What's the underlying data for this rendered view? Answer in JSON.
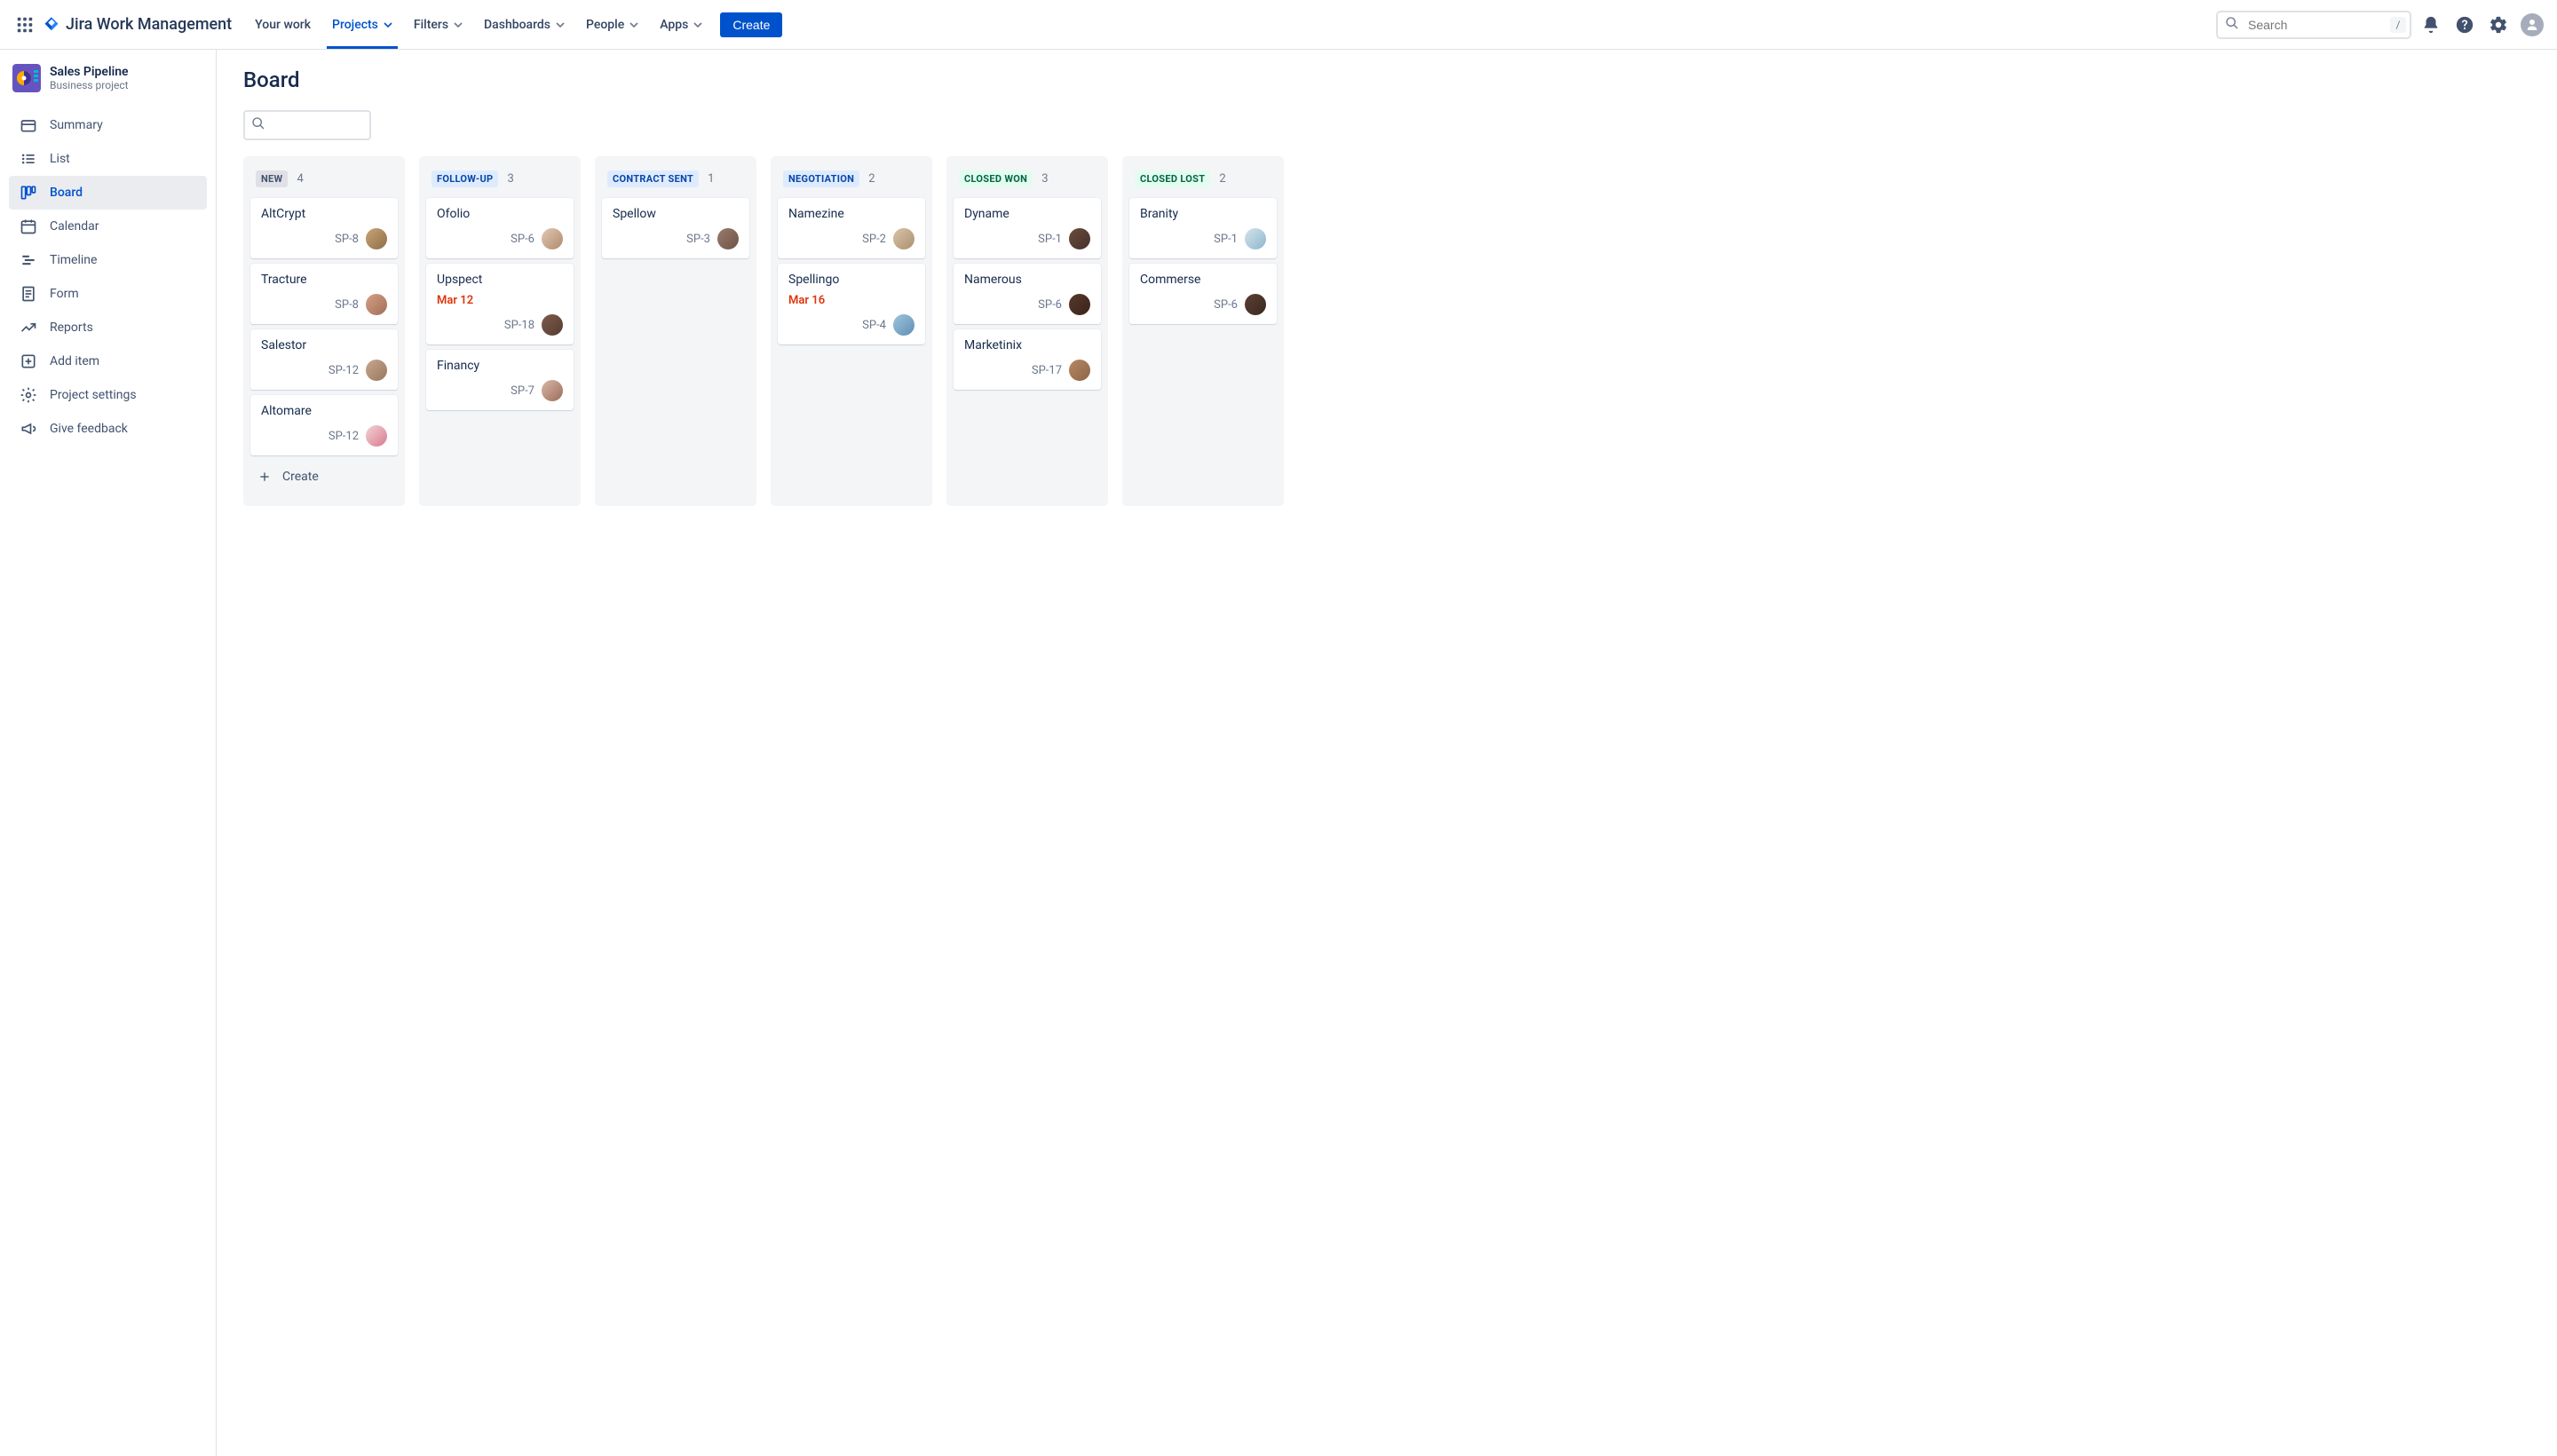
{
  "app_name": "Jira Work Management",
  "nav": {
    "your_work": "Your work",
    "projects": "Projects",
    "filters": "Filters",
    "dashboards": "Dashboards",
    "people": "People",
    "apps": "Apps",
    "create": "Create"
  },
  "search": {
    "placeholder": "Search",
    "shortcut": "/"
  },
  "project": {
    "name": "Sales Pipeline",
    "subtitle": "Business project"
  },
  "sidebar": {
    "summary": "Summary",
    "list": "List",
    "board": "Board",
    "calendar": "Calendar",
    "timeline": "Timeline",
    "form": "Form",
    "reports": "Reports",
    "add_item": "Add item",
    "project_settings": "Project settings",
    "give_feedback": "Give feedback"
  },
  "page_title": "Board",
  "columns": [
    {
      "title": "NEW",
      "count": "4",
      "status": "grey",
      "cards": [
        {
          "title": "AltCrypt",
          "key": "SP-8",
          "avatar": "linear-gradient(135deg,#c9a574,#8f6d49)"
        },
        {
          "title": "Tracture",
          "key": "SP-8",
          "avatar": "linear-gradient(135deg,#d4a088,#a06f55)"
        },
        {
          "title": "Salestor",
          "key": "SP-12",
          "avatar": "linear-gradient(135deg,#c9a88f,#96765c)"
        },
        {
          "title": "Altomare",
          "key": "SP-12",
          "avatar": "linear-gradient(135deg,#f2d4d4,#d97a8f)"
        }
      ],
      "show_create": true
    },
    {
      "title": "FOLLOW-UP",
      "count": "3",
      "status": "blue",
      "cards": [
        {
          "title": "Ofolio",
          "key": "SP-6",
          "avatar": "linear-gradient(135deg,#e2c9b4,#b0896b)"
        },
        {
          "title": "Upspect",
          "date": "Mar 12",
          "key": "SP-18",
          "avatar": "linear-gradient(135deg,#7d5c4b,#553c30)"
        },
        {
          "title": "Financy",
          "key": "SP-7",
          "avatar": "linear-gradient(135deg,#d9b8a8,#9a6c5c)"
        }
      ]
    },
    {
      "title": "CONTRACT SENT",
      "count": "1",
      "status": "blue",
      "cards": [
        {
          "title": "Spellow",
          "key": "SP-3",
          "avatar": "linear-gradient(135deg,#9c7b6a,#6c5348)"
        }
      ]
    },
    {
      "title": "NEGOTIATION",
      "count": "2",
      "status": "blue",
      "cards": [
        {
          "title": "Namezine",
          "key": "SP-2",
          "avatar": "linear-gradient(135deg,#d9c4a9,#ac8f6e)"
        },
        {
          "title": "Spellingo",
          "date": "Mar 16",
          "key": "SP-4",
          "avatar": "linear-gradient(135deg,#a0c4dd,#5f8fb3)"
        }
      ]
    },
    {
      "title": "CLOSED WON",
      "count": "3",
      "status": "green",
      "cards": [
        {
          "title": "Dyname",
          "key": "SP-1",
          "avatar": "linear-gradient(135deg,#6b4d3d,#44302a)"
        },
        {
          "title": "Namerous",
          "key": "SP-6",
          "avatar": "linear-gradient(135deg,#57392c,#39231b)"
        },
        {
          "title": "Marketinix",
          "key": "SP-17",
          "avatar": "linear-gradient(135deg,#b88964,#8b6446)"
        }
      ]
    },
    {
      "title": "CLOSED LOST",
      "count": "2",
      "status": "green",
      "cards": [
        {
          "title": "Branity",
          "key": "SP-1",
          "avatar": "linear-gradient(135deg,#d5e4ec,#8db5cc)"
        },
        {
          "title": "Commerse",
          "key": "SP-6",
          "avatar": "linear-gradient(135deg,#5c3f33,#3a281f)"
        }
      ]
    }
  ],
  "create_label": "Create"
}
